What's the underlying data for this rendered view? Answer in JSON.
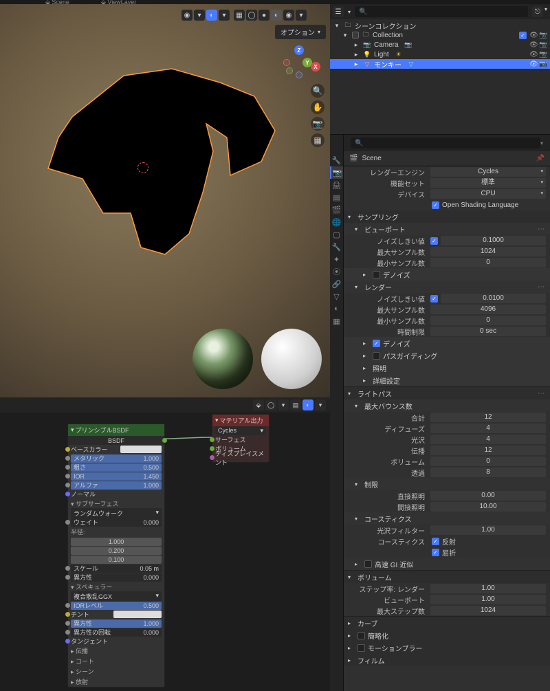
{
  "top": {
    "scene_icon": "Scene",
    "viewlayer": "ViewLayer"
  },
  "viewport": {
    "option_label": "オプション",
    "axis": {
      "x": "X",
      "y": "Y",
      "z": "Z"
    }
  },
  "outliner": {
    "search_placeholder": "",
    "scene_collection": "シーンコレクション",
    "collection": "Collection",
    "items": [
      {
        "name": "Camera",
        "icon": "camera"
      },
      {
        "name": "Light",
        "icon": "light"
      },
      {
        "name": "モンキー",
        "icon": "mesh",
        "selected": true
      }
    ]
  },
  "properties": {
    "scene_label": "Scene",
    "render_engine_label": "レンダーエンジン",
    "render_engine_value": "Cycles",
    "feature_set_label": "機能セット",
    "feature_set_value": "標準",
    "device_label": "デバイス",
    "device_value": "CPU",
    "osl_checked": true,
    "osl_label": "Open Shading Language",
    "sampling": {
      "title": "サンプリング",
      "viewport": {
        "title": "ビューポート",
        "noise_threshold_label": "ノイズしきい値",
        "noise_threshold_checked": true,
        "noise_threshold_value": "0.1000",
        "max_samples_label": "最大サンプル数",
        "max_samples_value": "1024",
        "min_samples_label": "最小サンプル数",
        "min_samples_value": "0",
        "denoise_title": "デノイズ",
        "denoise_checked": false
      },
      "render": {
        "title": "レンダー",
        "noise_threshold_label": "ノイズしきい値",
        "noise_threshold_checked": true,
        "noise_threshold_value": "0.0100",
        "max_samples_label": "最大サンプル数",
        "max_samples_value": "4096",
        "min_samples_label": "最小サンプル数",
        "min_samples_value": "0",
        "time_limit_label": "時間制限",
        "time_limit_value": "0 sec",
        "denoise_title": "デノイズ",
        "denoise_checked": true,
        "path_guiding_title": "パスガイディング",
        "path_guiding_checked": false,
        "lighting_title": "照明",
        "advanced_title": "詳細設定"
      }
    },
    "light_paths": {
      "title": "ライトパス",
      "max_bounces_title": "最大バウンス数",
      "total_label": "合計",
      "total_value": "12",
      "diffuse_label": "ディフューズ",
      "diffuse_value": "4",
      "glossy_label": "光沢",
      "glossy_value": "4",
      "transmission_label": "伝播",
      "transmission_value": "12",
      "volume_label": "ボリューム",
      "volume_value": "0",
      "transparent_label": "透過",
      "transparent_value": "8",
      "clamping_title": "制限",
      "direct_label": "直接照明",
      "direct_value": "0.00",
      "indirect_label": "間接照明",
      "indirect_value": "10.00",
      "caustics_title": "コースティクス",
      "filter_glossy_label": "光沢フィルター",
      "filter_glossy_value": "1.00",
      "caustics_label": "コースティクス",
      "reflective_label": "反射",
      "refractive_label": "屈折",
      "reflective_checked": true,
      "refractive_checked": true,
      "fast_gi_title": "高速 GI 近似",
      "fast_gi_checked": false
    },
    "volumes": {
      "title": "ボリューム",
      "step_rate_label": "ステップ率: レンダー",
      "step_rate_value": "1.00",
      "viewport_label": "ビューポート",
      "viewport_value": "1.00",
      "max_steps_label": "最大ステップ数",
      "max_steps_value": "1024"
    },
    "sections": {
      "curves": "カーブ",
      "simplify": "簡略化",
      "simplify_checked": false,
      "motion_blur": "モーションブラー",
      "motion_blur_checked": false,
      "film": "フィルム"
    }
  },
  "nodes": {
    "bsdf": {
      "title": "プリンシプルBSDF",
      "bsdf_out": "BSDF",
      "base_color": "ベースカラー",
      "metallic": "メタリック",
      "metallic_val": "1.000",
      "roughness": "粗さ",
      "roughness_val": "0.500",
      "ior": "IOR",
      "ior_val": "1.450",
      "alpha": "アルファ",
      "alpha_val": "1.000",
      "normal": "ノーマル",
      "subsurface": "サブサーフェス",
      "subsurface_method": "ランダムウォーク",
      "weight": "ウェイト",
      "weight_val": "0.000",
      "radius": "半径:",
      "r1": "1.000",
      "r2": "0.200",
      "r3": "0.100",
      "scale": "スケール",
      "scale_val": "0.05 m",
      "anisotropy1": "異方性",
      "anisotropy1_val": "0.000",
      "specular": "スペキュラー",
      "dist": "複合散乱GGX",
      "ior_level": "IORレベル",
      "ior_level_val": "0.500",
      "tint": "チント",
      "anisotropic": "異方性",
      "anisotropic_val": "1.000",
      "anisotropic_rot": "異方性の回転",
      "anisotropic_rot_val": "0.000",
      "tangent": "タンジェント",
      "extra1": "伝播",
      "extra2": "コート",
      "extra3": "シーン",
      "extra4": "放射"
    },
    "output": {
      "title": "マテリアル出力",
      "target": "Cycles",
      "surface": "サーフェス",
      "volume": "ボリューム",
      "displacement": "ディスプレイスメント"
    }
  }
}
